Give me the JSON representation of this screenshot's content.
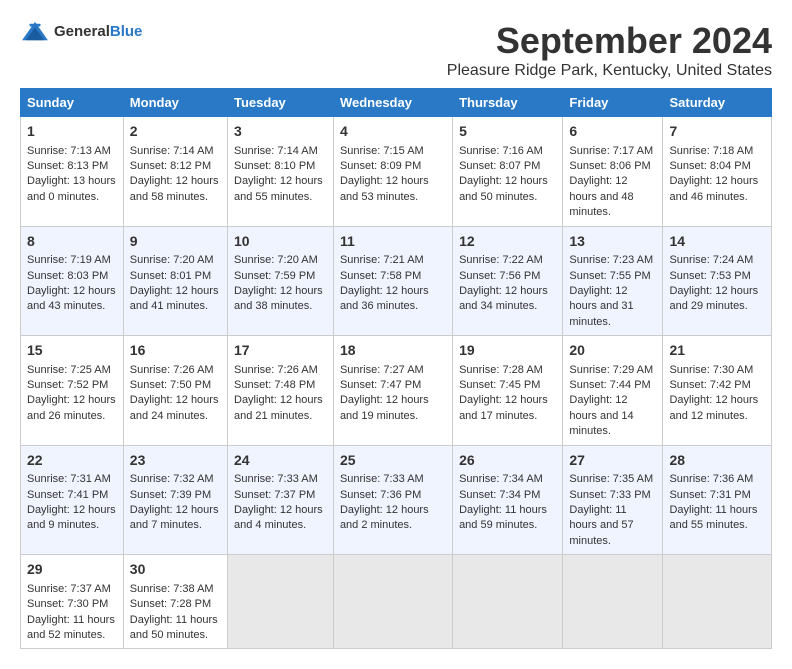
{
  "header": {
    "logo": {
      "text_general": "General",
      "text_blue": "Blue"
    },
    "main_title": "September 2024",
    "subtitle": "Pleasure Ridge Park, Kentucky, United States"
  },
  "calendar": {
    "days_of_week": [
      "Sunday",
      "Monday",
      "Tuesday",
      "Wednesday",
      "Thursday",
      "Friday",
      "Saturday"
    ],
    "weeks": [
      [
        null,
        null,
        null,
        null,
        null,
        null,
        null
      ]
    ],
    "cells": [
      {
        "week": 0,
        "day": 0,
        "num": "1",
        "sunrise": "Sunrise: 7:13 AM",
        "sunset": "Sunset: 8:13 PM",
        "daylight": "Daylight: 13 hours and 0 minutes."
      },
      {
        "week": 0,
        "day": 1,
        "num": "2",
        "sunrise": "Sunrise: 7:14 AM",
        "sunset": "Sunset: 8:12 PM",
        "daylight": "Daylight: 12 hours and 58 minutes."
      },
      {
        "week": 0,
        "day": 2,
        "num": "3",
        "sunrise": "Sunrise: 7:14 AM",
        "sunset": "Sunset: 8:10 PM",
        "daylight": "Daylight: 12 hours and 55 minutes."
      },
      {
        "week": 0,
        "day": 3,
        "num": "4",
        "sunrise": "Sunrise: 7:15 AM",
        "sunset": "Sunset: 8:09 PM",
        "daylight": "Daylight: 12 hours and 53 minutes."
      },
      {
        "week": 0,
        "day": 4,
        "num": "5",
        "sunrise": "Sunrise: 7:16 AM",
        "sunset": "Sunset: 8:07 PM",
        "daylight": "Daylight: 12 hours and 50 minutes."
      },
      {
        "week": 0,
        "day": 5,
        "num": "6",
        "sunrise": "Sunrise: 7:17 AM",
        "sunset": "Sunset: 8:06 PM",
        "daylight": "Daylight: 12 hours and 48 minutes."
      },
      {
        "week": 0,
        "day": 6,
        "num": "7",
        "sunrise": "Sunrise: 7:18 AM",
        "sunset": "Sunset: 8:04 PM",
        "daylight": "Daylight: 12 hours and 46 minutes."
      },
      {
        "week": 1,
        "day": 0,
        "num": "8",
        "sunrise": "Sunrise: 7:19 AM",
        "sunset": "Sunset: 8:03 PM",
        "daylight": "Daylight: 12 hours and 43 minutes."
      },
      {
        "week": 1,
        "day": 1,
        "num": "9",
        "sunrise": "Sunrise: 7:20 AM",
        "sunset": "Sunset: 8:01 PM",
        "daylight": "Daylight: 12 hours and 41 minutes."
      },
      {
        "week": 1,
        "day": 2,
        "num": "10",
        "sunrise": "Sunrise: 7:20 AM",
        "sunset": "Sunset: 7:59 PM",
        "daylight": "Daylight: 12 hours and 38 minutes."
      },
      {
        "week": 1,
        "day": 3,
        "num": "11",
        "sunrise": "Sunrise: 7:21 AM",
        "sunset": "Sunset: 7:58 PM",
        "daylight": "Daylight: 12 hours and 36 minutes."
      },
      {
        "week": 1,
        "day": 4,
        "num": "12",
        "sunrise": "Sunrise: 7:22 AM",
        "sunset": "Sunset: 7:56 PM",
        "daylight": "Daylight: 12 hours and 34 minutes."
      },
      {
        "week": 1,
        "day": 5,
        "num": "13",
        "sunrise": "Sunrise: 7:23 AM",
        "sunset": "Sunset: 7:55 PM",
        "daylight": "Daylight: 12 hours and 31 minutes."
      },
      {
        "week": 1,
        "day": 6,
        "num": "14",
        "sunrise": "Sunrise: 7:24 AM",
        "sunset": "Sunset: 7:53 PM",
        "daylight": "Daylight: 12 hours and 29 minutes."
      },
      {
        "week": 2,
        "day": 0,
        "num": "15",
        "sunrise": "Sunrise: 7:25 AM",
        "sunset": "Sunset: 7:52 PM",
        "daylight": "Daylight: 12 hours and 26 minutes."
      },
      {
        "week": 2,
        "day": 1,
        "num": "16",
        "sunrise": "Sunrise: 7:26 AM",
        "sunset": "Sunset: 7:50 PM",
        "daylight": "Daylight: 12 hours and 24 minutes."
      },
      {
        "week": 2,
        "day": 2,
        "num": "17",
        "sunrise": "Sunrise: 7:26 AM",
        "sunset": "Sunset: 7:48 PM",
        "daylight": "Daylight: 12 hours and 21 minutes."
      },
      {
        "week": 2,
        "day": 3,
        "num": "18",
        "sunrise": "Sunrise: 7:27 AM",
        "sunset": "Sunset: 7:47 PM",
        "daylight": "Daylight: 12 hours and 19 minutes."
      },
      {
        "week": 2,
        "day": 4,
        "num": "19",
        "sunrise": "Sunrise: 7:28 AM",
        "sunset": "Sunset: 7:45 PM",
        "daylight": "Daylight: 12 hours and 17 minutes."
      },
      {
        "week": 2,
        "day": 5,
        "num": "20",
        "sunrise": "Sunrise: 7:29 AM",
        "sunset": "Sunset: 7:44 PM",
        "daylight": "Daylight: 12 hours and 14 minutes."
      },
      {
        "week": 2,
        "day": 6,
        "num": "21",
        "sunrise": "Sunrise: 7:30 AM",
        "sunset": "Sunset: 7:42 PM",
        "daylight": "Daylight: 12 hours and 12 minutes."
      },
      {
        "week": 3,
        "day": 0,
        "num": "22",
        "sunrise": "Sunrise: 7:31 AM",
        "sunset": "Sunset: 7:41 PM",
        "daylight": "Daylight: 12 hours and 9 minutes."
      },
      {
        "week": 3,
        "day": 1,
        "num": "23",
        "sunrise": "Sunrise: 7:32 AM",
        "sunset": "Sunset: 7:39 PM",
        "daylight": "Daylight: 12 hours and 7 minutes."
      },
      {
        "week": 3,
        "day": 2,
        "num": "24",
        "sunrise": "Sunrise: 7:33 AM",
        "sunset": "Sunset: 7:37 PM",
        "daylight": "Daylight: 12 hours and 4 minutes."
      },
      {
        "week": 3,
        "day": 3,
        "num": "25",
        "sunrise": "Sunrise: 7:33 AM",
        "sunset": "Sunset: 7:36 PM",
        "daylight": "Daylight: 12 hours and 2 minutes."
      },
      {
        "week": 3,
        "day": 4,
        "num": "26",
        "sunrise": "Sunrise: 7:34 AM",
        "sunset": "Sunset: 7:34 PM",
        "daylight": "Daylight: 11 hours and 59 minutes."
      },
      {
        "week": 3,
        "day": 5,
        "num": "27",
        "sunrise": "Sunrise: 7:35 AM",
        "sunset": "Sunset: 7:33 PM",
        "daylight": "Daylight: 11 hours and 57 minutes."
      },
      {
        "week": 3,
        "day": 6,
        "num": "28",
        "sunrise": "Sunrise: 7:36 AM",
        "sunset": "Sunset: 7:31 PM",
        "daylight": "Daylight: 11 hours and 55 minutes."
      },
      {
        "week": 4,
        "day": 0,
        "num": "29",
        "sunrise": "Sunrise: 7:37 AM",
        "sunset": "Sunset: 7:30 PM",
        "daylight": "Daylight: 11 hours and 52 minutes."
      },
      {
        "week": 4,
        "day": 1,
        "num": "30",
        "sunrise": "Sunrise: 7:38 AM",
        "sunset": "Sunset: 7:28 PM",
        "daylight": "Daylight: 11 hours and 50 minutes."
      }
    ]
  }
}
